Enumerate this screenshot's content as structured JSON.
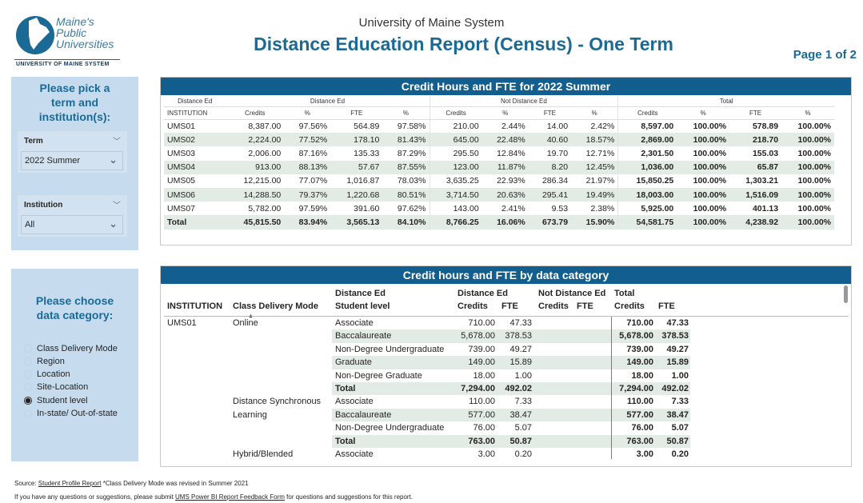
{
  "logo": {
    "line1": "Maine's",
    "line2": "Public",
    "line3": "Universities",
    "sub": "UNIVERSITY OF MAINE SYSTEM"
  },
  "header": {
    "subtitle": "University of Maine System",
    "title": "Distance Education Report (Census) - One Term",
    "page": "Page 1 of 2"
  },
  "colors": {
    "brand": "#125e8e",
    "title_blue": "#1b6a95",
    "panel": "#c6dbee",
    "row_shade": "#e3ebe5"
  },
  "filters": {
    "heading_lines": [
      "Please pick a",
      "term and",
      "institution(s):"
    ],
    "term": {
      "label": "Term",
      "value": "2022 Summer"
    },
    "institution": {
      "label": "Institution",
      "value": "All"
    }
  },
  "category": {
    "heading_lines": [
      "Please choose",
      "data category:"
    ],
    "options": [
      "Class Delivery Mode",
      "Region",
      "Location",
      "Site-Location",
      "Student level",
      "In-state/ Out-of-state"
    ],
    "selected": "Student level"
  },
  "table1": {
    "title": "Credit Hours and FTE for 2022 Summer",
    "group_headers": [
      "Distance Ed",
      "Distance Ed",
      "Not Distance Ed",
      "Total"
    ],
    "col_headers": [
      "INSTITUTION",
      "Credits",
      "%",
      "FTE",
      "%",
      "Credits",
      "%",
      "FTE",
      "%",
      "Credits",
      "%",
      "FTE",
      "%"
    ],
    "rows": [
      [
        "UMS01",
        "8,387.00",
        "97.56%",
        "564.89",
        "97.58%",
        "210.00",
        "2.44%",
        "14.00",
        "2.42%",
        "8,597.00",
        "100.00%",
        "578.89",
        "100.00%"
      ],
      [
        "UMS02",
        "2,224.00",
        "77.52%",
        "178.10",
        "81.43%",
        "645.00",
        "22.48%",
        "40.60",
        "18.57%",
        "2,869.00",
        "100.00%",
        "218.70",
        "100.00%"
      ],
      [
        "UMS03",
        "2,006.00",
        "87.16%",
        "135.33",
        "87.29%",
        "295.50",
        "12.84%",
        "19.70",
        "12.71%",
        "2,301.50",
        "100.00%",
        "155.03",
        "100.00%"
      ],
      [
        "UMS04",
        "913.00",
        "88.13%",
        "57.67",
        "87.55%",
        "123.00",
        "11.87%",
        "8.20",
        "12.45%",
        "1,036.00",
        "100.00%",
        "65.87",
        "100.00%"
      ],
      [
        "UMS05",
        "12,215.00",
        "77.07%",
        "1,016.87",
        "78.03%",
        "3,635.25",
        "22.93%",
        "286.34",
        "21.97%",
        "15,850.25",
        "100.00%",
        "1,303.21",
        "100.00%"
      ],
      [
        "UMS06",
        "14,288.50",
        "79.37%",
        "1,220.68",
        "80.51%",
        "3,714.50",
        "20.63%",
        "295.41",
        "19.49%",
        "18,003.00",
        "100.00%",
        "1,516.09",
        "100.00%"
      ],
      [
        "UMS07",
        "5,782.00",
        "97.59%",
        "391.60",
        "97.62%",
        "143.00",
        "2.41%",
        "9.53",
        "2.38%",
        "5,925.00",
        "100.00%",
        "401.13",
        "100.00%"
      ]
    ],
    "total": [
      "Total",
      "45,815.50",
      "83.94%",
      "3,565.13",
      "84.10%",
      "8,766.25",
      "16.06%",
      "673.79",
      "15.90%",
      "54,581.75",
      "100.00%",
      "4,238.92",
      "100.00%"
    ]
  },
  "table2": {
    "title": "Credit hours and FTE by data category",
    "headers": {
      "institution": "INSTITUTION",
      "mode": "Class Delivery Mode",
      "level_top": "Distance Ed",
      "level": "Student level",
      "de": "Distance Ed",
      "nde": "Not Distance Ed",
      "total": "Total",
      "credits": "Credits",
      "fte": "FTE"
    },
    "rows": [
      {
        "inst": "UMS01",
        "mode": "Online",
        "level": "Associate",
        "de_credits": "710.00",
        "de_fte": "47.33",
        "tot_credits": "710.00",
        "tot_fte": "47.33",
        "shade": false,
        "total": false
      },
      {
        "inst": "",
        "mode": "",
        "level": "Baccalaureate",
        "de_credits": "5,678.00",
        "de_fte": "378.53",
        "tot_credits": "5,678.00",
        "tot_fte": "378.53",
        "shade": true,
        "total": false
      },
      {
        "inst": "",
        "mode": "",
        "level": "Non-Degree Undergraduate",
        "de_credits": "739.00",
        "de_fte": "49.27",
        "tot_credits": "739.00",
        "tot_fte": "49.27",
        "shade": false,
        "total": false
      },
      {
        "inst": "",
        "mode": "",
        "level": "Graduate",
        "de_credits": "149.00",
        "de_fte": "15.89",
        "tot_credits": "149.00",
        "tot_fte": "15.89",
        "shade": true,
        "total": false
      },
      {
        "inst": "",
        "mode": "",
        "level": "Non-Degree Graduate",
        "de_credits": "18.00",
        "de_fte": "1.00",
        "tot_credits": "18.00",
        "tot_fte": "1.00",
        "shade": false,
        "total": false
      },
      {
        "inst": "",
        "mode": "",
        "level": "Total",
        "de_credits": "7,294.00",
        "de_fte": "492.02",
        "tot_credits": "7,294.00",
        "tot_fte": "492.02",
        "shade": true,
        "total": true
      },
      {
        "inst": "",
        "mode": "Distance Synchronous",
        "level": "Associate",
        "de_credits": "110.00",
        "de_fte": "7.33",
        "tot_credits": "110.00",
        "tot_fte": "7.33",
        "shade": false,
        "total": false
      },
      {
        "inst": "",
        "mode": "Learning",
        "level": "Baccalaureate",
        "de_credits": "577.00",
        "de_fte": "38.47",
        "tot_credits": "577.00",
        "tot_fte": "38.47",
        "shade": true,
        "total": false
      },
      {
        "inst": "",
        "mode": "",
        "level": "Non-Degree Undergraduate",
        "de_credits": "76.00",
        "de_fte": "5.07",
        "tot_credits": "76.00",
        "tot_fte": "5.07",
        "shade": false,
        "total": false
      },
      {
        "inst": "",
        "mode": "",
        "level": "Total",
        "de_credits": "763.00",
        "de_fte": "50.87",
        "tot_credits": "763.00",
        "tot_fte": "50.87",
        "shade": true,
        "total": true
      },
      {
        "inst": "",
        "mode": "Hybrid/Blended",
        "level": "Associate",
        "de_credits": "3.00",
        "de_fte": "0.20",
        "tot_credits": "3.00",
        "tot_fte": "0.20",
        "shade": false,
        "total": false
      }
    ]
  },
  "footer": {
    "source_prefix": "Source: ",
    "source_link": "Student Profile Report",
    "source_note": " *Class Delivery Mode was revised in Summer 2021",
    "feedback_prefix": "If you have any questions or suggestions, please submit ",
    "feedback_link": "UMS Power BI Report Feedback Form",
    "feedback_suffix": " for questions and suggestions for this report."
  }
}
